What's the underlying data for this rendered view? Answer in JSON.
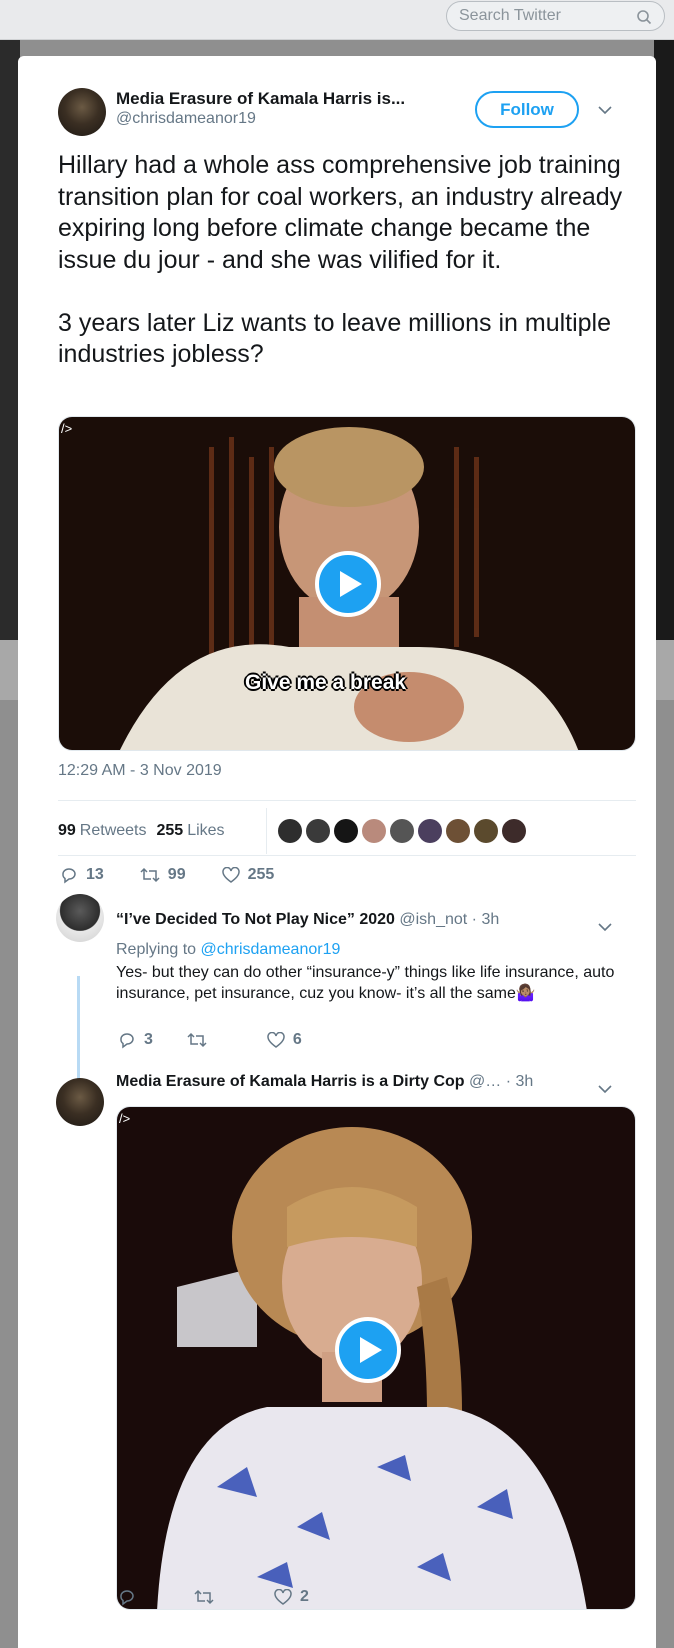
{
  "search": {
    "placeholder": "Search Twitter"
  },
  "tweet": {
    "author_name": "Media Erasure of Kamala Harris is...",
    "author_handle": "@chrisdameanor19",
    "follow_label": "Follow",
    "text": "Hillary had a whole ass comprehensive job training transition plan for coal workers, an industry already expiring long before climate change became the issue du jour - and she was vilified for it.\n\n3 years later Liz wants to leave millions in multiple industries jobless?",
    "media_alt": "/>",
    "media_caption": "Give me a break",
    "timestamp": "12:29 AM - 3 Nov 2019",
    "retweets_count": "99",
    "retweets_label": "Retweets",
    "likes_count": "255",
    "likes_label": "Likes",
    "reply_count": "13",
    "retweet_action_count": "99",
    "like_action_count": "255"
  },
  "reply1": {
    "author_name": "“I’ve Decided To Not Play Nice” 2020",
    "author_handle": "@ish_not",
    "time": "· 3h",
    "replying_prefix": "Replying to",
    "replying_to": "@chrisdameanor19",
    "text": "Yes- but they can do other “insurance-y” things like life insurance, auto insurance, pet insurance, cuz you know- it’s all the same🤷🏽‍♀️",
    "reply_count": "3",
    "retweet_count": "",
    "like_count": "6"
  },
  "reply2": {
    "author_name": "Media Erasure of Kamala Harris is a Dirty Cop",
    "author_handle": "@…",
    "time": "· 3h",
    "media_alt": "/>",
    "reply_count": "",
    "retweet_count": "",
    "like_count": "2"
  },
  "colors": {
    "accent": "#1da1f2",
    "text": "#14171a",
    "muted": "#657786",
    "thread_line": "#b8daf4"
  }
}
